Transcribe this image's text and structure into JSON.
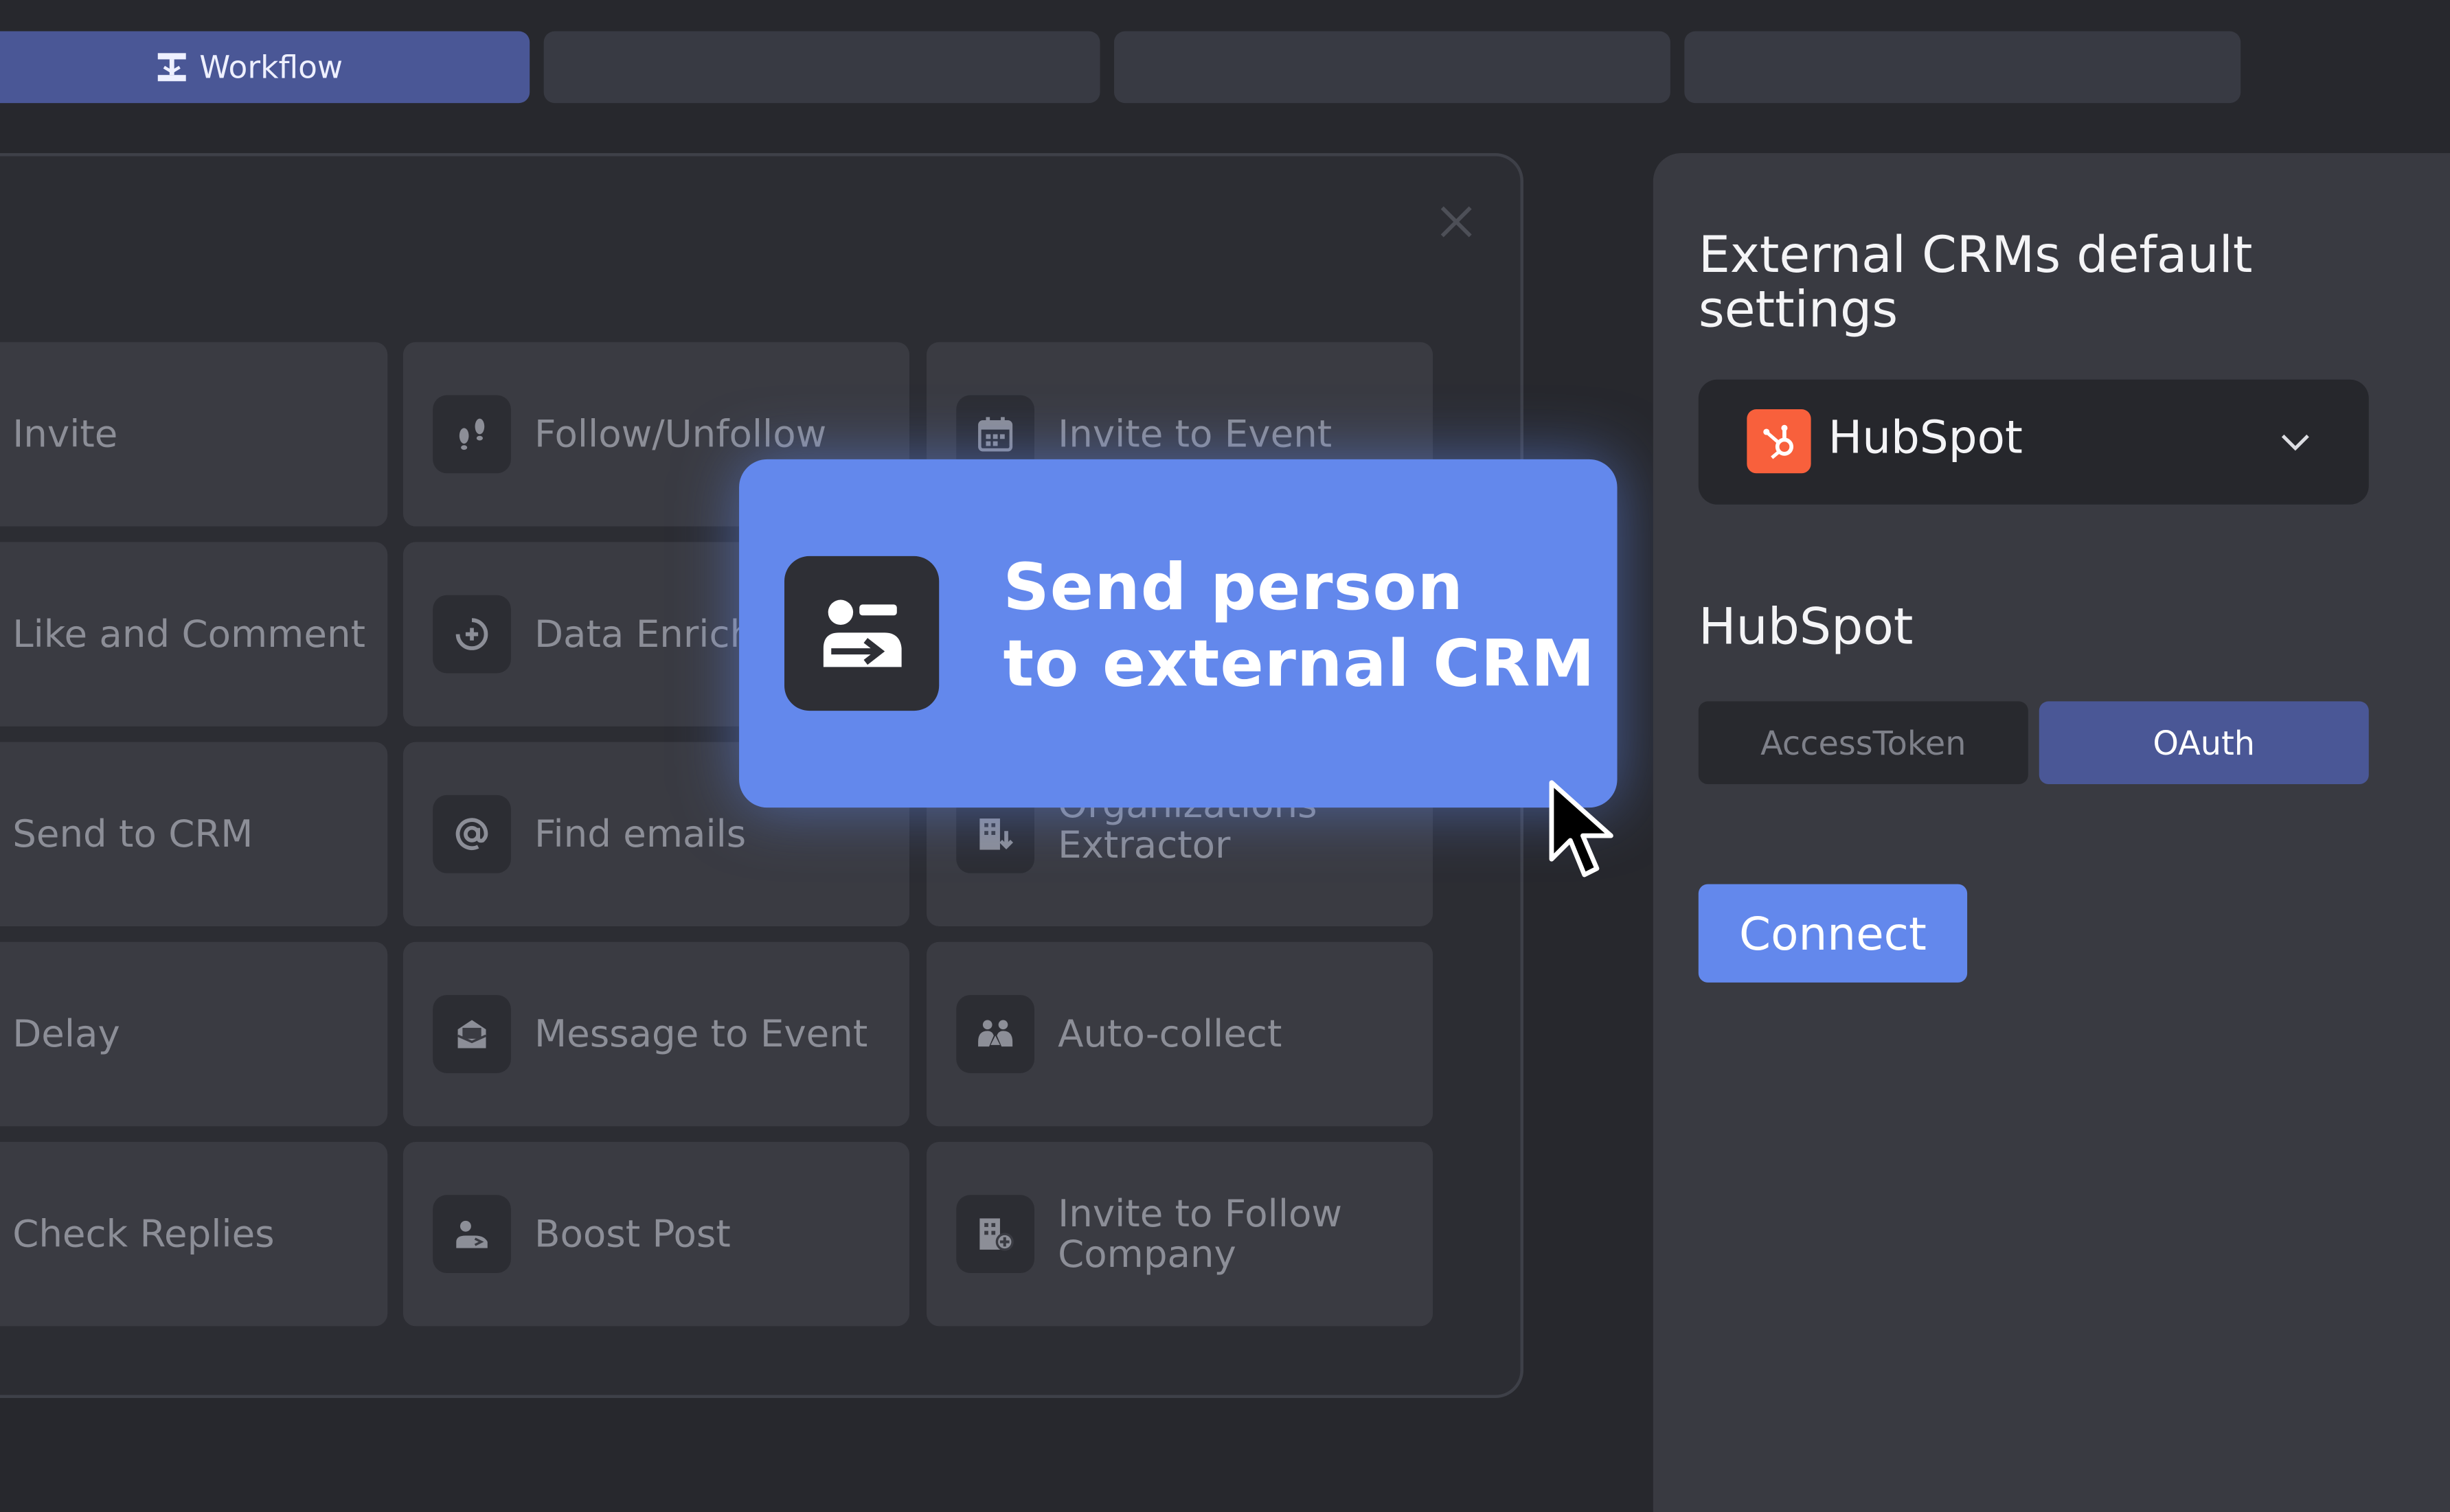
{
  "tabs": [
    {
      "label": "Workflow",
      "icon": "workflow-icon",
      "active": true
    },
    {
      "label": "",
      "active": false
    },
    {
      "label": "",
      "active": false
    },
    {
      "label": "",
      "active": false
    }
  ],
  "actions": [
    {
      "label": "Invite",
      "icon": "none"
    },
    {
      "label": "Follow/Unfollow",
      "icon": "footsteps-icon"
    },
    {
      "label": "Invite to Event",
      "icon": "calendar-icon"
    },
    {
      "label": "Like and Comment",
      "icon": "none"
    },
    {
      "label": "Data Enrich",
      "icon": "enrich-icon"
    },
    {
      "label": "Send to CRM",
      "icon": "none"
    },
    {
      "label": "Find emails",
      "icon": "at-icon"
    },
    {
      "label": "Organizations\nExtractor",
      "icon": "building-download-icon"
    },
    {
      "label": "Delay",
      "icon": "none"
    },
    {
      "label": "Message to Event",
      "icon": "message-icon"
    },
    {
      "label": "Auto-collect",
      "icon": "people-icon"
    },
    {
      "label": "Check Replies",
      "icon": "none"
    },
    {
      "label": "Boost Post",
      "icon": "boost-icon"
    },
    {
      "label": "Invite to Follow\nCompany",
      "icon": "building-plus-icon"
    }
  ],
  "popup": {
    "label": "Send person\nto external CRM",
    "icon": "send-person-icon"
  },
  "settings": {
    "title": "External CRMs default settings",
    "crm_select": {
      "value": "HubSpot",
      "icon": "hubspot-logo-icon"
    },
    "crm_heading": "HubSpot",
    "auth_options": [
      "AccessToken",
      "OAuth"
    ],
    "auth_selected": "OAuth",
    "connect_label": "Connect"
  },
  "colors": {
    "background": "#27282d",
    "accent": "#6388ec",
    "active_tab": "#4a5796",
    "hubspot": "#f8603c"
  }
}
